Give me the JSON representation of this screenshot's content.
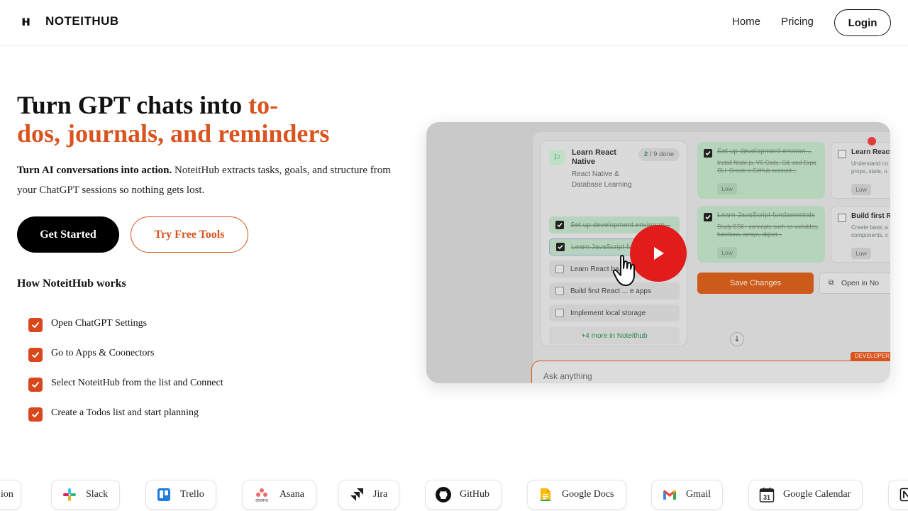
{
  "header": {
    "brand": "NOTEITHUB",
    "logo_mark": "ʜ",
    "nav_home": "Home",
    "nav_pricing": "Pricing",
    "login": "Login"
  },
  "hero": {
    "title_part1": "Turn GPT chats into ",
    "title_accent_a": "to-",
    "title_accent_b": "dos, journals, and reminders",
    "subtitle_bold": "Turn AI conversations into action.",
    "subtitle_rest": " NoteitHub extracts tasks, goals, and structure from your ChatGPT sessions so nothing gets lost.",
    "cta_primary": "Get Started",
    "cta_secondary": "Try Free Tools"
  },
  "how": {
    "title": "How NoteitHub works",
    "steps": [
      "Open ChatGPT Settings",
      "Go to Apps & Coonectors",
      "Select NoteitHub from the list and Connect",
      "Create a Todos list and start planning"
    ]
  },
  "video": {
    "project_title": "Learn React Native",
    "project_sub": "React Native & Database Learning",
    "done_count": "2",
    "done_total": "/ 9  done",
    "tasks": [
      {
        "text": "Set up development environm...",
        "done": true
      },
      {
        "text": "Learn JavaScript fund...",
        "done": true
      },
      {
        "text": "Learn React ba...",
        "done": false
      },
      {
        "text": "Build first React ... e apps",
        "done": false
      },
      {
        "text": "Implement local storage",
        "done": false
      }
    ],
    "more_link": "+4 more in Noteithub",
    "cards": [
      {
        "title": "Set up development environ...",
        "desc": "Install Node.js, VS Code, Git, and Expo CLI. Create a GitHub account...",
        "priority": "Low",
        "done": true
      },
      {
        "title": "Learn React",
        "desc": "Understand co props, state, u",
        "priority": "Low",
        "done": false
      },
      {
        "title": "Learn JavaScript fundamentals",
        "desc": "Study ES6+ concepts such as variables, functions, arrays, object...",
        "priority": "Low",
        "done": true
      },
      {
        "title": "Build first R",
        "desc": "Create basic a components, c",
        "priority": "Low",
        "done": false
      }
    ],
    "save_label": "Save Changes",
    "open_label": "Open in No",
    "down_arrow": "↓",
    "dev_tag": "DEVELOPER",
    "ask_placeholder": "Ask anything"
  },
  "integrations": [
    {
      "label": "ion",
      "icon": "notion-icon"
    },
    {
      "label": "Slack",
      "icon": "slack-icon"
    },
    {
      "label": "Trello",
      "icon": "trello-icon"
    },
    {
      "label": "Asana",
      "icon": "asana-icon"
    },
    {
      "label": "Jira",
      "icon": "jira-icon"
    },
    {
      "label": "GitHub",
      "icon": "github-icon"
    },
    {
      "label": "Google Docs",
      "icon": "google-docs-icon"
    },
    {
      "label": "Gmail",
      "icon": "gmail-icon"
    },
    {
      "label": "Google Calendar",
      "icon": "google-calendar-icon",
      "calendar_day": "31"
    }
  ],
  "colors": {
    "accent": "#d9541e",
    "checkbox": "#d9471c",
    "play": "#e21b1b"
  }
}
